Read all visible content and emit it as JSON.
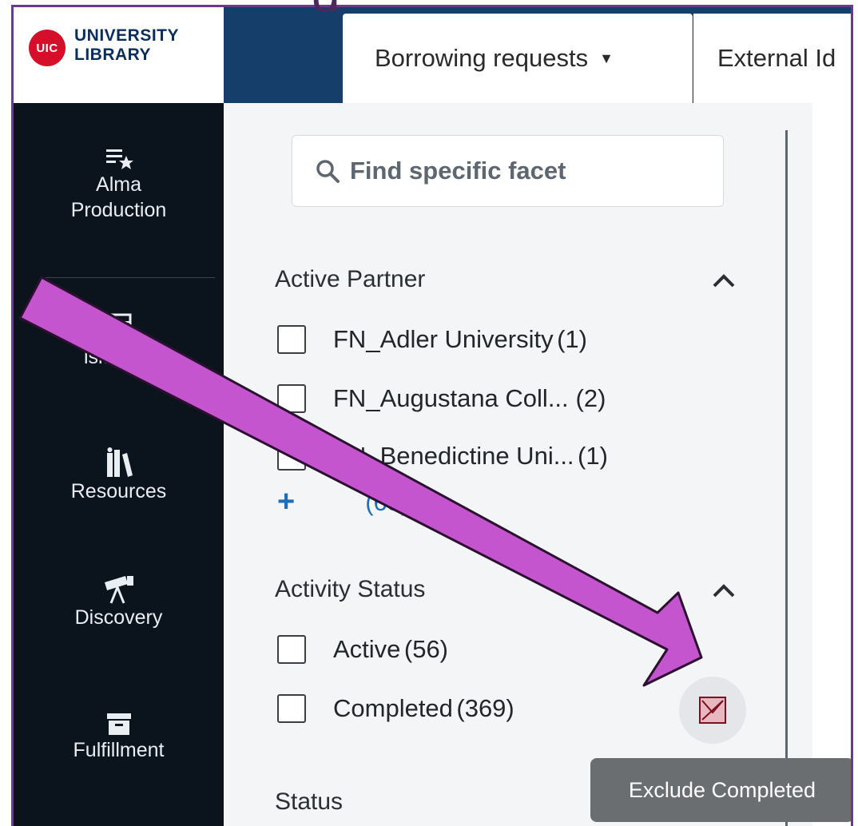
{
  "header": {
    "logo_badge": "UIC",
    "logo_line1": "UNIVERSITY",
    "logo_line2": "LIBRARY",
    "tabs": [
      {
        "label": "Borrowing requests",
        "has_dropdown": true
      },
      {
        "label": "External Id"
      }
    ],
    "title_fragment": "g"
  },
  "sidebar": {
    "items": [
      {
        "label_line1": "Alma",
        "label_line2": "Production",
        "icon": "list-star-icon"
      },
      {
        "label": "Acquisitions",
        "visible_text": "isitions",
        "icon": "abacus-icon"
      },
      {
        "label": "Resources",
        "icon": "books-icon"
      },
      {
        "label": "Discovery",
        "icon": "telescope-icon"
      },
      {
        "label": "Fulfillment",
        "icon": "archive-box-icon"
      }
    ]
  },
  "facets": {
    "search_placeholder": "Find specific facet",
    "sections": [
      {
        "title": "Active Partner",
        "expanded": true,
        "items": [
          {
            "label": "FN_Adler University",
            "count": "(1)"
          },
          {
            "label": "FN_Augustana Coll...",
            "count": "(2)"
          },
          {
            "label": "FN_Benedictine Uni...",
            "count": "(1)"
          }
        ],
        "more_label": "(63)"
      },
      {
        "title": "Activity Status",
        "expanded": true,
        "items": [
          {
            "label": "Active",
            "count": "(56)"
          },
          {
            "label": "Completed",
            "count": "(369)"
          }
        ]
      },
      {
        "title": "Status"
      }
    ],
    "exclude_tooltip": "Exclude Completed"
  },
  "colors": {
    "header_bg": "#153e6a",
    "sidebar_bg": "#0b131d",
    "annotation_arrow": "#c455cf",
    "frame_border": "#6a3c88",
    "uic_red": "#d50f2a"
  }
}
